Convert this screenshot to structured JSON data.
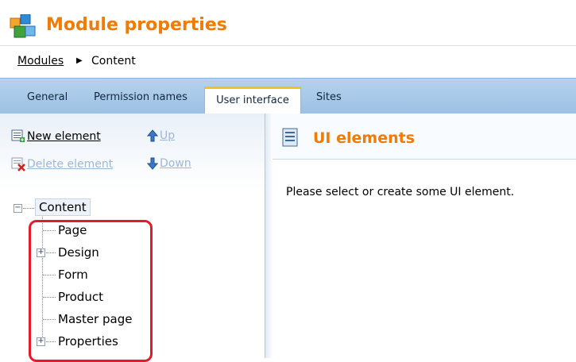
{
  "title": "Module properties",
  "breadcrumb": {
    "modules_link": "Modules",
    "current": "Content"
  },
  "tabs": [
    "General",
    "Permission names",
    "User interface",
    "Sites"
  ],
  "toolbar": {
    "new_element": "New element",
    "up": "Up",
    "delete_element": "Delete element",
    "down": "Down"
  },
  "tree": {
    "root": "Content",
    "children": [
      "Page",
      "Design",
      "Form",
      "Product",
      "Master page",
      "Properties"
    ]
  },
  "right": {
    "title": "UI elements",
    "message": "Please select or create some UI element."
  },
  "colors": {
    "accent_orange": "#f07b05",
    "tab_bar": "#b6d2ec",
    "highlight": "#e31c2a"
  }
}
